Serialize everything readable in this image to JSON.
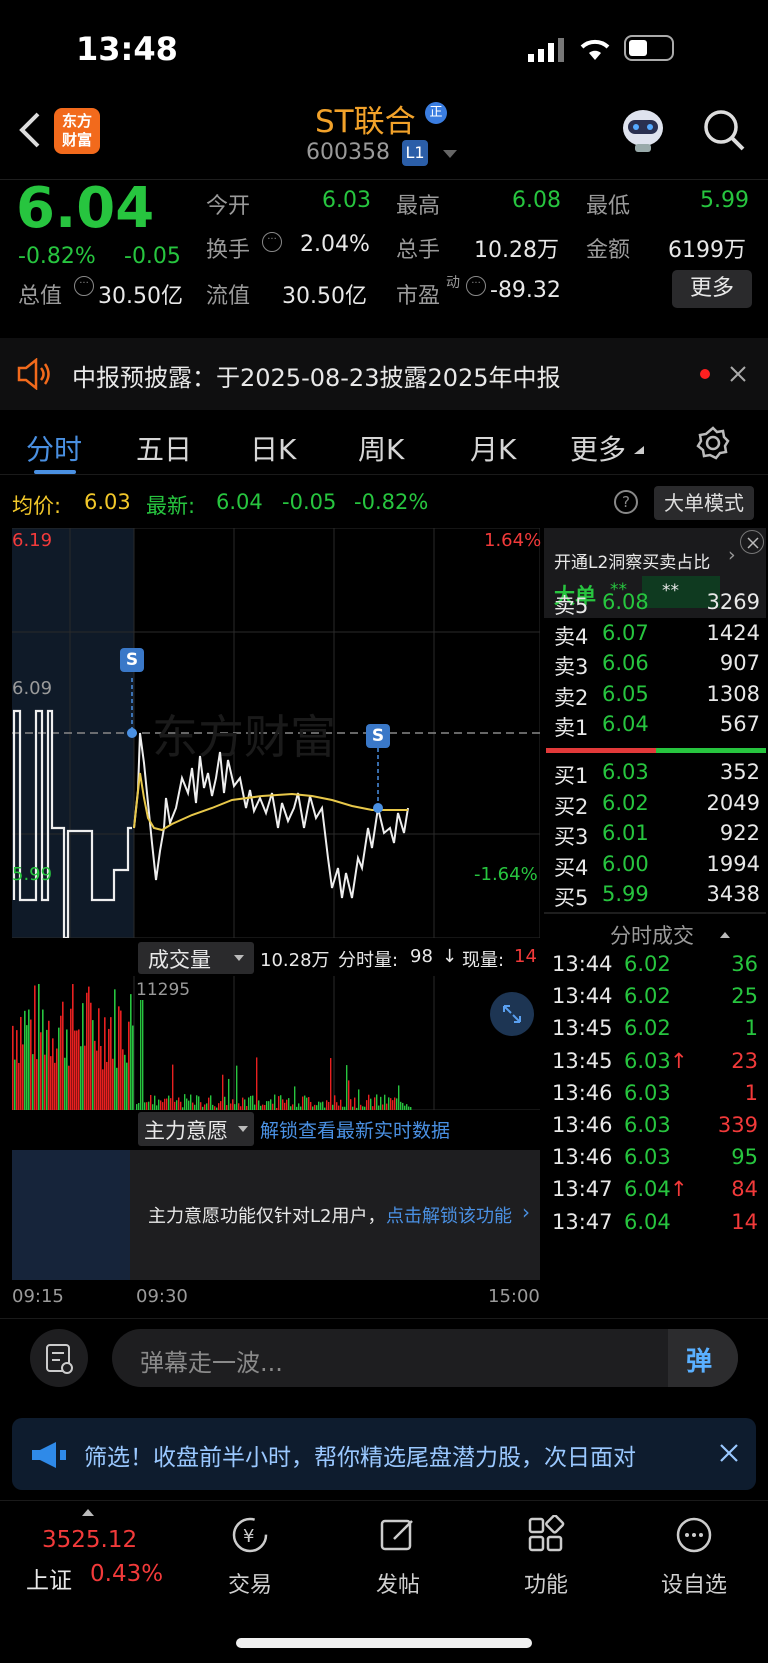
{
  "status": {
    "time": "13:48"
  },
  "header": {
    "title": "ST联合",
    "title_badge": "正",
    "code": "600358",
    "level_badge": "L1",
    "logo_text_line1": "东方",
    "logo_text_line2": "财富"
  },
  "quote": {
    "price": "6.04",
    "pct": "-0.82%",
    "chg": "-0.05",
    "fields": [
      {
        "label": "今开",
        "value": "6.03"
      },
      {
        "label": "最高",
        "value": "6.08"
      },
      {
        "label": "最低",
        "value": "5.99"
      },
      {
        "label": "换手",
        "value": "2.04%"
      },
      {
        "label": "总手",
        "value": "10.28万"
      },
      {
        "label": "金额",
        "value": "6199万"
      },
      {
        "label": "总值",
        "value": "30.50亿"
      },
      {
        "label": "流值",
        "value": "30.50亿"
      },
      {
        "label": "市盈",
        "value": "-89.32"
      }
    ],
    "pe_sup": "动",
    "more_button": "更多"
  },
  "notice": {
    "text": "中报预披露：于2025-08-23披露2025年中报"
  },
  "tabs": [
    "分时",
    "五日",
    "日K",
    "周K",
    "月K",
    "更多"
  ],
  "chart_info": {
    "avg_label": "均价:",
    "avg_value": "6.03",
    "latest_label": "最新:",
    "latest_value": "6.04",
    "latest_chg": "-0.05",
    "latest_pct": "-0.82%",
    "mode_button": "大单模式",
    "help": "?"
  },
  "chart_labels": {
    "y_top": "6.19",
    "y_mid": "6.09",
    "y_bottom": "5.99",
    "pct_top": "1.64%",
    "pct_bottom": "-1.64%",
    "s_marker": "S",
    "watermark": "东方财富"
  },
  "volume_bar": {
    "label": "成交量",
    "total": "10.28万",
    "tick_label": "分时量:",
    "tick_value": "98",
    "arrow": "↓",
    "now_label": "现量:",
    "now_value": "14",
    "peak": "11295"
  },
  "force_bar": {
    "label": "主力意愿",
    "unlock_text": "解锁查看最新实时数据",
    "panel_text": "主力意愿功能仅针对L2用户，",
    "panel_link": "点击解锁该功能"
  },
  "x_axis": {
    "t0": "09:15",
    "t1": "09:30",
    "t2": "15:00"
  },
  "l2_promo": {
    "text": "开通L2洞察买卖占比",
    "big_label": "大单",
    "stars1": "**",
    "stars2": "**"
  },
  "asks": [
    {
      "label": "卖5",
      "price": "6.08",
      "vol": "3269"
    },
    {
      "label": "卖4",
      "price": "6.07",
      "vol": "1424"
    },
    {
      "label": "卖3",
      "price": "6.06",
      "vol": "907"
    },
    {
      "label": "卖2",
      "price": "6.05",
      "vol": "1308"
    },
    {
      "label": "卖1",
      "price": "6.04",
      "vol": "567"
    }
  ],
  "bids": [
    {
      "label": "买1",
      "price": "6.03",
      "vol": "352"
    },
    {
      "label": "买2",
      "price": "6.02",
      "vol": "2049"
    },
    {
      "label": "买3",
      "price": "6.01",
      "vol": "922"
    },
    {
      "label": "买4",
      "price": "6.00",
      "vol": "1994"
    },
    {
      "label": "买5",
      "price": "5.99",
      "vol": "3438"
    }
  ],
  "ticks_title": "分时成交",
  "ticks": [
    {
      "time": "13:44",
      "price": "6.02",
      "arrow": "",
      "vol": "36",
      "pc": "green",
      "vc": "green"
    },
    {
      "time": "13:44",
      "price": "6.02",
      "arrow": "",
      "vol": "25",
      "pc": "green",
      "vc": "green"
    },
    {
      "time": "13:45",
      "price": "6.02",
      "arrow": "",
      "vol": "1",
      "pc": "green",
      "vc": "green"
    },
    {
      "time": "13:45",
      "price": "6.03",
      "arrow": "↑",
      "vol": "23",
      "pc": "green",
      "vc": "red"
    },
    {
      "time": "13:46",
      "price": "6.03",
      "arrow": "",
      "vol": "1",
      "pc": "green",
      "vc": "red"
    },
    {
      "time": "13:46",
      "price": "6.03",
      "arrow": "",
      "vol": "339",
      "pc": "green",
      "vc": "red"
    },
    {
      "time": "13:46",
      "price": "6.03",
      "arrow": "",
      "vol": "95",
      "pc": "green",
      "vc": "green"
    },
    {
      "time": "13:47",
      "price": "6.04",
      "arrow": "↑",
      "vol": "84",
      "pc": "green",
      "vc": "red"
    },
    {
      "time": "13:47",
      "price": "6.04",
      "arrow": "",
      "vol": "14",
      "pc": "green",
      "vc": "red"
    }
  ],
  "comment": {
    "placeholder": "弹幕走一波...",
    "send": "弹"
  },
  "banner": {
    "text": "筛选！收盘前半小时，帮你精选尾盘潜力股，次日面对"
  },
  "bottom_nav": {
    "index_value": "3525.12",
    "index_name": "上证",
    "index_pct": "0.43%",
    "items": [
      "交易",
      "发帖",
      "功能",
      "设自选"
    ]
  }
}
